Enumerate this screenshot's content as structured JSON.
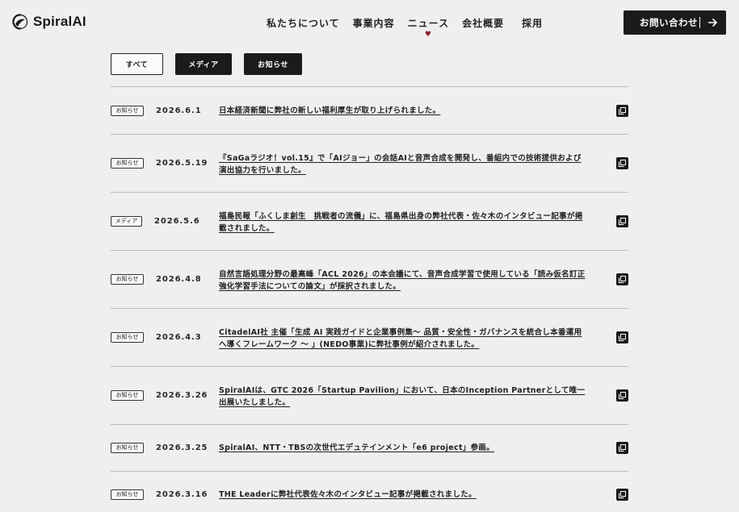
{
  "brand": {
    "name": "SpiralAI"
  },
  "nav": {
    "items": [
      "私たちについて",
      "事業内容",
      "ニュース",
      "会社概要",
      "採用"
    ],
    "active_index": 2,
    "active_marker": "♥"
  },
  "contact": {
    "label": "お問い合わせ"
  },
  "filters": [
    "すべて",
    "メディア",
    "お知らせ"
  ],
  "news": [
    {
      "tag": "お知らせ",
      "date": "2026.6.1",
      "title": "日本経済新聞に弊社の新しい福利厚生が取り上げられました。"
    },
    {
      "tag": "お知らせ",
      "date": "2026.5.19",
      "title": "『SaGaラジオ！vol.15』で「AIジョー」の会話AIと音声合成を開発し、番組内での技術提供および演出協力を行いました。"
    },
    {
      "tag": "メディア",
      "date": "2026.5.6",
      "title": "福島民報「ふくしま創生　挑戦者の流儀」に、福島県出身の弊社代表・佐々木のインタビュー記事が掲載されました。"
    },
    {
      "tag": "お知らせ",
      "date": "2026.4.8",
      "title": "自然言語処理分野の最高峰「ACL 2026」の本会議にて、音声合成学習で使用している「読み仮名訂正強化学習手法についての論文」が採択されました。"
    },
    {
      "tag": "お知らせ",
      "date": "2026.4.3",
      "title": "CitadelAI社 主催「生成 AI 実践ガイドと企業事例集〜 品質・安全性・ガバナンスを統合し本番運用へ導くフレームワーク 〜 」(NEDO事業)に弊社事例が紹介されました。"
    },
    {
      "tag": "お知らせ",
      "date": "2026.3.26",
      "title": "SpiralAIは、GTC 2026「Startup Pavilion」において、日本のInception Partnerとして唯一出展いたしました。"
    },
    {
      "tag": "お知らせ",
      "date": "2026.3.25",
      "title": "SpiralAI、NTT・TBSの次世代エデュテインメント「e6 project」参画。"
    },
    {
      "tag": "お知らせ",
      "date": "2026.3.16",
      "title": "THE Leaderに弊社代表佐々木のインタビュー記事が掲載されました。"
    }
  ]
}
